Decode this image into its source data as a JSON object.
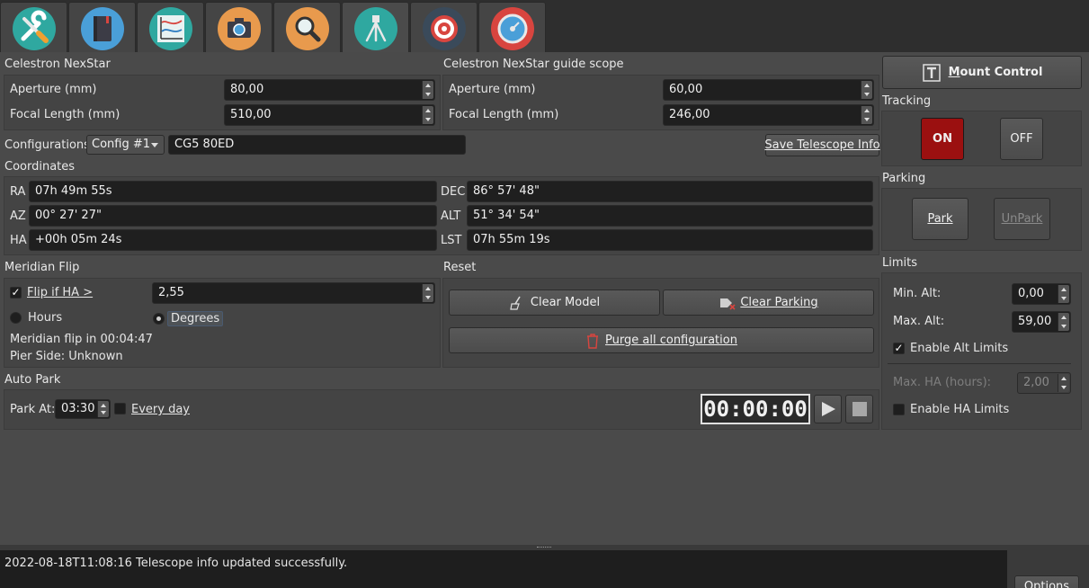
{
  "tabs": [
    {
      "name": "tools",
      "color": "#2fa8a0"
    },
    {
      "name": "notebook",
      "color": "#4a9fd8"
    },
    {
      "name": "analyze",
      "color": "#2fa8a0"
    },
    {
      "name": "camera",
      "color": "#e89a4d"
    },
    {
      "name": "search",
      "color": "#e89a4d"
    },
    {
      "name": "telescope",
      "color": "#2fa8a0"
    },
    {
      "name": "target",
      "color": "#d8453f"
    },
    {
      "name": "guide",
      "color": "#d8453f"
    }
  ],
  "telescope": {
    "primary_title": "Celestron NexStar",
    "guide_title": "Celestron NexStar guide scope",
    "aperture_label": "Aperture (mm)",
    "focal_label": "Focal Length (mm)",
    "primary_aperture": "80,00",
    "primary_focal": "510,00",
    "guide_aperture": "60,00",
    "guide_focal": "246,00"
  },
  "config": {
    "label": "Configurations",
    "selected": "Config #1",
    "name": "CG5 80ED",
    "save_label": "Save Telescope Info"
  },
  "coords": {
    "title": "Coordinates",
    "ra_label": "RA",
    "ra": "07h 49m 55s",
    "dec_label": "DEC",
    "dec": "86° 57' 48\"",
    "az_label": "AZ",
    "az": " 00° 27' 27\"",
    "alt_label": "ALT",
    "alt": "51° 34' 54\"",
    "ha_label": "HA",
    "ha": "+00h 05m 24s",
    "lst_label": "LST",
    "lst": "07h 55m 19s"
  },
  "meridian": {
    "title": "Meridian Flip",
    "flip_label": "Flip if HA >",
    "flip_value": "2,55",
    "hours_label": "Hours",
    "degrees_label": "Degrees",
    "flip_in": "Meridian flip in 00:04:47",
    "pier_side": "Pier Side: Unknown"
  },
  "reset": {
    "title": "Reset",
    "clear_model": "Clear  Model",
    "clear_parking": "Clear Parking",
    "purge": "Purge all configuration"
  },
  "autopark": {
    "title": "Auto Park",
    "park_at_label": "Park At:",
    "park_at": "03:30",
    "every_day": "Every day",
    "timer": "00:00:00"
  },
  "side": {
    "mount_control": "Mount Control",
    "tracking_title": "Tracking",
    "on_label": "ON",
    "off_label": "OFF",
    "parking_title": "Parking",
    "park_label": "Park",
    "unpark_label": "UnPark",
    "limits_title": "Limits",
    "min_alt_label": "Min. Alt:",
    "min_alt": "0,00",
    "max_alt_label": "Max. Alt:",
    "max_alt": "59,00",
    "enable_alt": "Enable Alt Limits",
    "max_ha_label": "Max. HA (hours):",
    "max_ha": "2,00",
    "enable_ha": "Enable HA Limits"
  },
  "status": {
    "log": "2022-08-18T11:08:16 Telescope info updated successfully.",
    "options_label": "Options"
  },
  "colors": {
    "on_active": "#9b1010",
    "accent_teal": "#2fa8a0"
  }
}
